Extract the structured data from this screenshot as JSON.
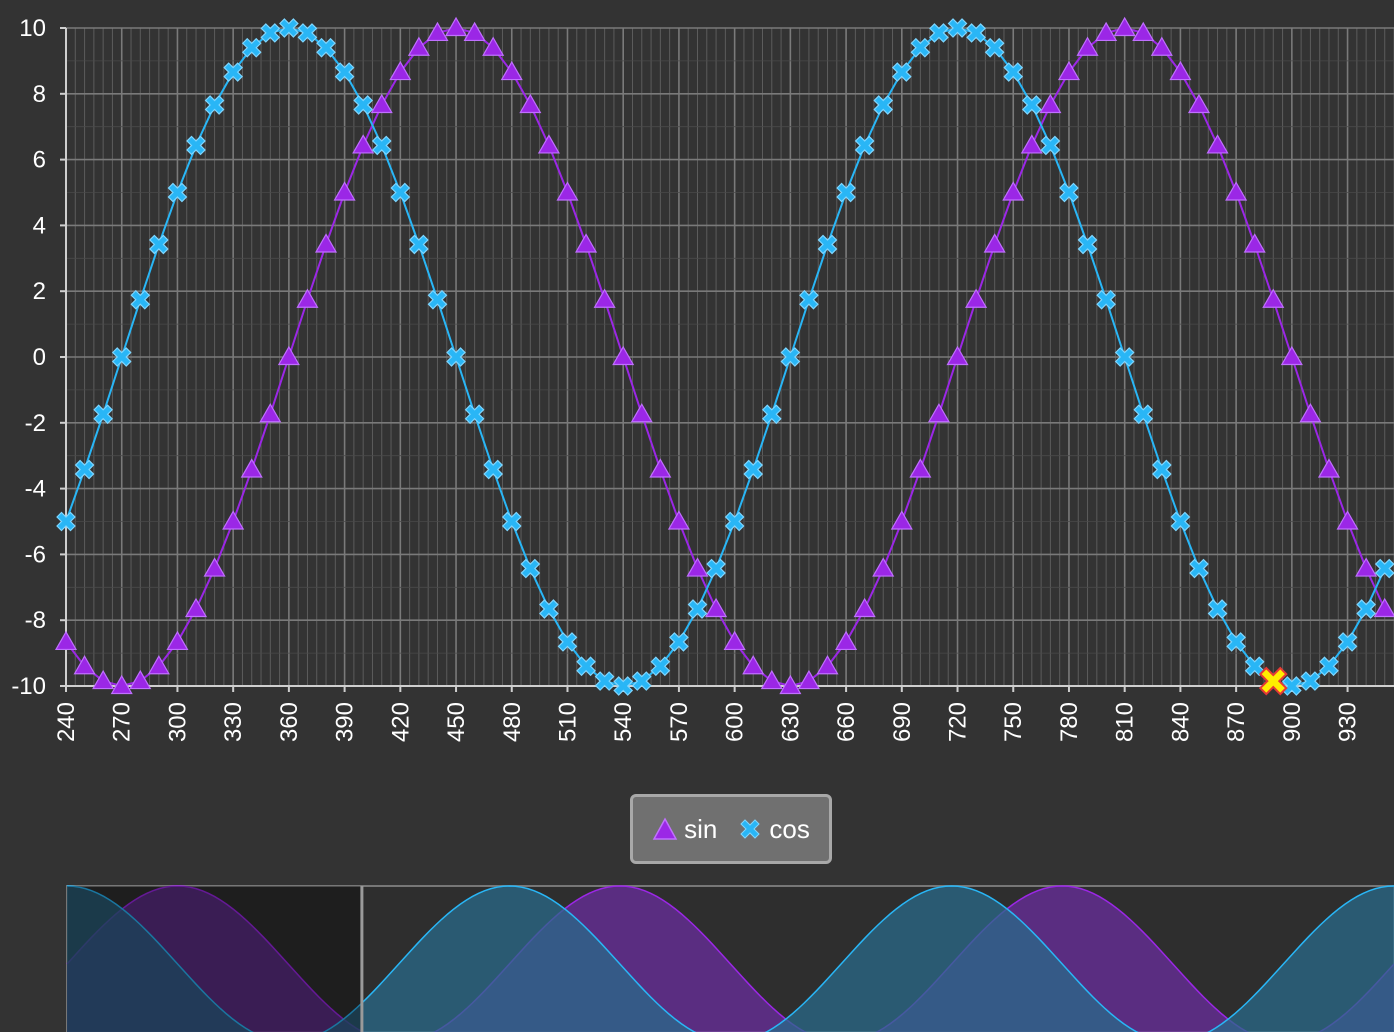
{
  "chart_data": {
    "type": "line",
    "title": "",
    "xlabel": "",
    "ylabel": "",
    "xlim": [
      240,
      955
    ],
    "ylim": [
      -10,
      10
    ],
    "x_ticks": [
      240,
      270,
      300,
      330,
      360,
      390,
      420,
      450,
      480,
      510,
      540,
      570,
      600,
      630,
      660,
      690,
      720,
      750,
      780,
      810,
      840,
      870,
      900,
      930
    ],
    "y_ticks": [
      10,
      8,
      6,
      4,
      2,
      0,
      -2,
      -4,
      -6,
      -8,
      -10
    ],
    "grid": true,
    "legend_position": "bottom-center",
    "series": [
      {
        "name": "sin",
        "color": "#9b27e6",
        "marker": "triangle",
        "x": [
          240,
          250,
          260,
          270,
          280,
          290,
          300,
          310,
          320,
          330,
          340,
          350,
          360,
          370,
          380,
          390,
          400,
          410,
          420,
          430,
          440,
          450,
          460,
          470,
          480,
          490,
          500,
          510,
          520,
          530,
          540,
          550,
          560,
          570,
          580,
          590,
          600,
          610,
          620,
          630,
          640,
          650,
          660,
          670,
          680,
          690,
          700,
          710,
          720,
          730,
          740,
          750,
          760,
          770,
          780,
          790,
          800,
          810,
          820,
          830,
          840,
          850,
          860,
          870,
          880,
          890,
          900,
          910,
          920,
          930,
          940,
          950
        ],
        "y": [
          -8.66,
          -9.4,
          -9.85,
          -10.0,
          -9.85,
          -9.4,
          -8.66,
          -7.66,
          -6.43,
          -5.0,
          -3.42,
          -1.74,
          0.0,
          1.74,
          3.42,
          5.0,
          6.43,
          7.66,
          8.66,
          9.4,
          9.85,
          10.0,
          9.85,
          9.4,
          8.66,
          7.66,
          6.43,
          5.0,
          3.42,
          1.74,
          0.0,
          -1.74,
          -3.42,
          -5.0,
          -6.43,
          -7.66,
          -8.66,
          -9.4,
          -9.85,
          -10.0,
          -9.85,
          -9.4,
          -8.66,
          -7.66,
          -6.43,
          -5.0,
          -3.42,
          -1.74,
          0.0,
          1.74,
          3.42,
          5.0,
          6.43,
          7.66,
          8.66,
          9.4,
          9.85,
          10.0,
          9.85,
          9.4,
          8.66,
          7.66,
          6.43,
          5.0,
          3.42,
          1.74,
          0.0,
          -1.74,
          -3.42,
          -5.0,
          -6.43,
          -7.66
        ]
      },
      {
        "name": "cos",
        "color": "#29b6f6",
        "marker": "cross",
        "x": [
          240,
          250,
          260,
          270,
          280,
          290,
          300,
          310,
          320,
          330,
          340,
          350,
          360,
          370,
          380,
          390,
          400,
          410,
          420,
          430,
          440,
          450,
          460,
          470,
          480,
          490,
          500,
          510,
          520,
          530,
          540,
          550,
          560,
          570,
          580,
          590,
          600,
          610,
          620,
          630,
          640,
          650,
          660,
          670,
          680,
          690,
          700,
          710,
          720,
          730,
          740,
          750,
          760,
          770,
          780,
          790,
          800,
          810,
          820,
          830,
          840,
          850,
          860,
          870,
          880,
          890,
          900,
          910,
          920,
          930,
          940,
          950
        ],
        "y": [
          -5.0,
          -3.42,
          -1.74,
          0.0,
          1.74,
          3.42,
          5.0,
          6.43,
          7.66,
          8.66,
          9.4,
          9.85,
          10.0,
          9.85,
          9.4,
          8.66,
          7.66,
          6.43,
          5.0,
          3.42,
          1.74,
          0.0,
          -1.74,
          -3.42,
          -5.0,
          -6.43,
          -7.66,
          -8.66,
          -9.4,
          -9.85,
          -10.0,
          -9.85,
          -9.4,
          -8.66,
          -7.66,
          -6.43,
          -5.0,
          -3.42,
          -1.74,
          0.0,
          1.74,
          3.42,
          5.0,
          6.43,
          7.66,
          8.66,
          9.4,
          9.85,
          10.0,
          9.85,
          9.4,
          8.66,
          7.66,
          6.43,
          5.0,
          3.42,
          1.74,
          0.0,
          -1.74,
          -3.42,
          -5.0,
          -6.43,
          -7.66,
          -8.66,
          -9.4,
          -9.85,
          -10.0,
          -9.85,
          -9.4,
          -8.66,
          -7.66,
          -6.43
        ]
      }
    ],
    "highlighted_point": {
      "series": "cos",
      "x": 890,
      "y": -9.85,
      "color": "#ffee00",
      "outline": "#e53935"
    },
    "navigator": {
      "x_range": [
        0,
        1080
      ],
      "selected_range": [
        240,
        955
      ],
      "colors": {
        "sin_fill": "#6a2e9e",
        "cos_fill": "#2a6a8a"
      }
    }
  },
  "legend": {
    "sin_label": "sin",
    "cos_label": "cos"
  }
}
